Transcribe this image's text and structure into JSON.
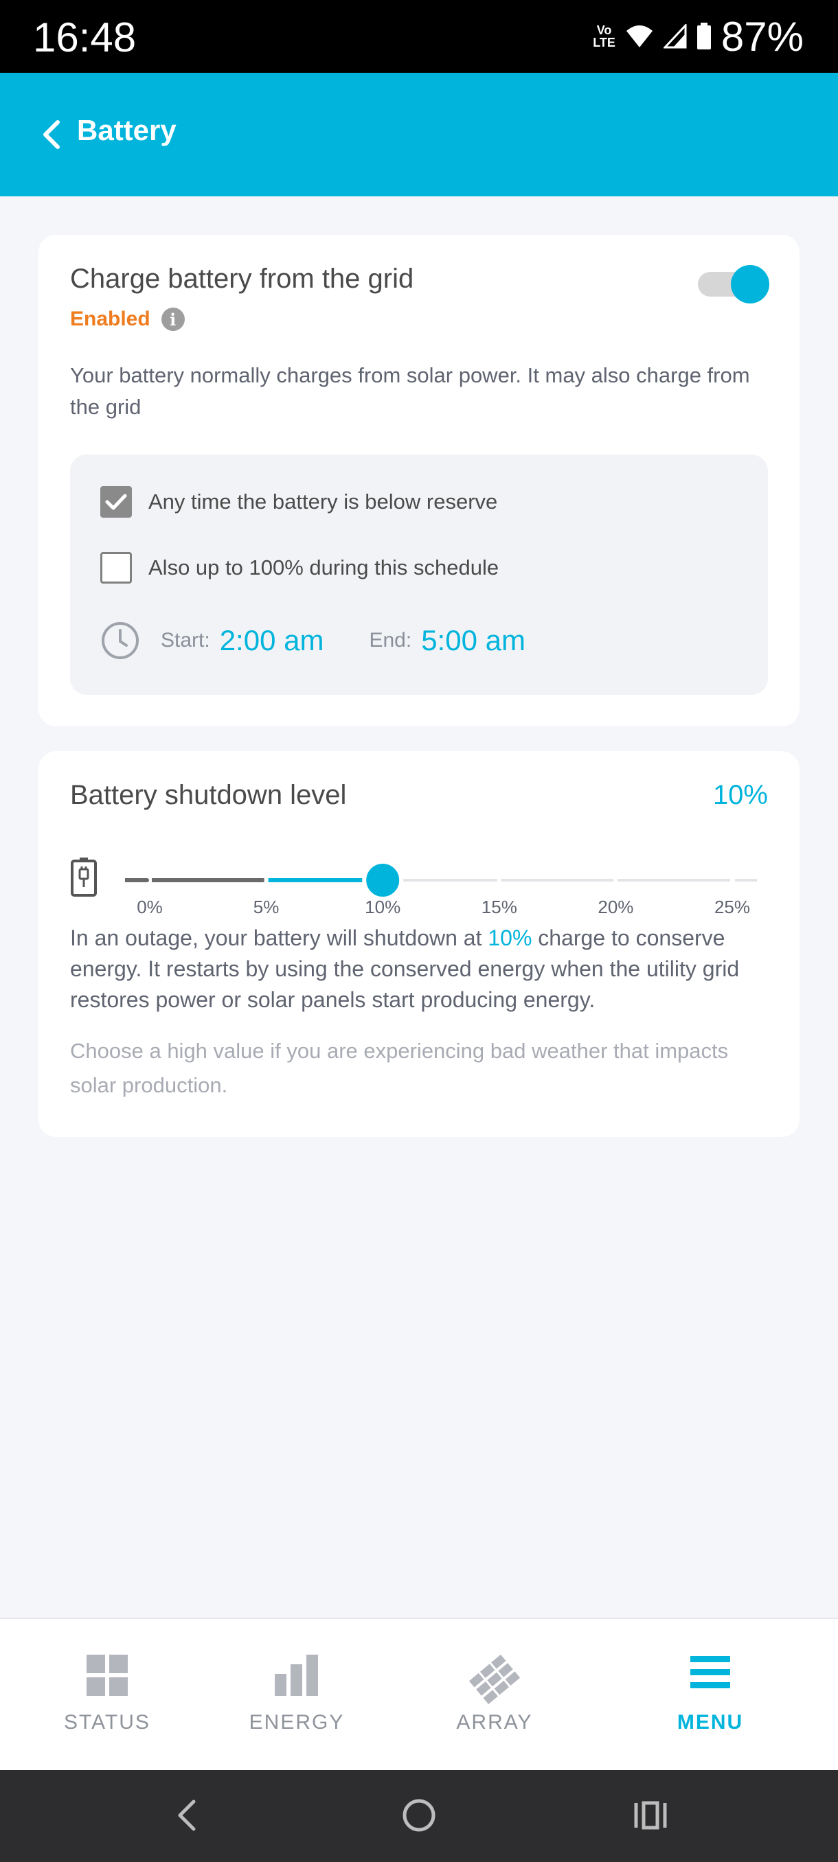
{
  "status_bar": {
    "time": "16:48",
    "volte_line1": "Vo",
    "volte_line2": "LTE",
    "battery_percent": "87%"
  },
  "app_bar": {
    "title": "Battery",
    "back_icon": "chevron-left-icon"
  },
  "grid_charge": {
    "title": "Charge battery from the grid",
    "toggle_on": true,
    "status": "Enabled",
    "description": "Your battery normally charges from solar power. It may also charge from the grid",
    "options": [
      {
        "label": "Any time the battery is below reserve",
        "checked": true
      },
      {
        "label": "Also up to 100% during this schedule",
        "checked": false
      }
    ],
    "schedule": {
      "start_label": "Start:",
      "start_value": "2:00 am",
      "end_label": "End:",
      "end_value": "5:00 am"
    }
  },
  "shutdown": {
    "title": "Battery shutdown level",
    "value_label": "10%",
    "value_fraction": 0.4,
    "tick_labels": [
      "0%",
      "5%",
      "10%",
      "15%",
      "20%",
      "25%"
    ],
    "outage_before": "In an outage, your battery will shutdown at ",
    "outage_highlight": "10%",
    "outage_after": " charge to conserve energy. It restarts by using the conserved energy when the utility grid restores power or solar panels start producing energy.",
    "hint": "Choose a high value if you are experiencing bad weather that impacts solar production."
  },
  "bottom_nav": [
    {
      "label": "STATUS",
      "icon": "grid-icon",
      "active": false
    },
    {
      "label": "ENERGY",
      "icon": "bar-chart-icon",
      "active": false
    },
    {
      "label": "ARRAY",
      "icon": "solar-panel-icon",
      "active": false
    },
    {
      "label": "MENU",
      "icon": "menu-icon",
      "active": true
    }
  ],
  "colors": {
    "accent": "#00b4dc",
    "enabled": "#ef7d20",
    "status_bar": "#000000",
    "system_nav": "#2d2d2f"
  }
}
